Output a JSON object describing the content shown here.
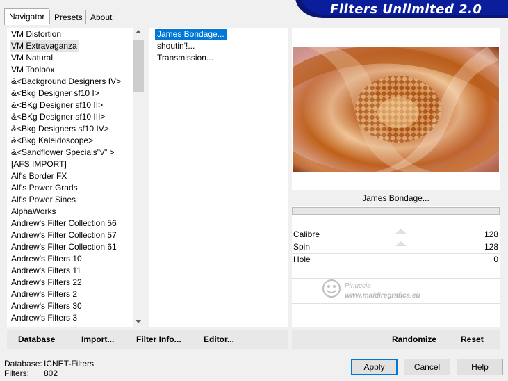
{
  "tabs": [
    "Navigator",
    "Presets",
    "About"
  ],
  "banner": "Filters Unlimited 2.0",
  "categories": [
    "VM Distortion",
    "VM Extravaganza",
    "VM Natural",
    "VM Toolbox",
    "&<Background Designers IV>",
    "&<Bkg Designer sf10 I>",
    "&<BKg Designer sf10 II>",
    "&<BKg Designer sf10 III>",
    "&<Bkg Designers sf10 IV>",
    "&<Bkg Kaleidoscope>",
    "&<Sandflower Specials\"v\" >",
    "[AFS IMPORT]",
    "Alf's Border FX",
    "Alf's Power Grads",
    "Alf's Power Sines",
    "AlphaWorks",
    "Andrew's Filter Collection 56",
    "Andrew's Filter Collection 57",
    "Andrew's Filter Collection 61",
    "Andrew's Filters 10",
    "Andrew's Filters 11",
    "Andrew's Filters 22",
    "Andrew's Filters 2",
    "Andrew's Filters 30",
    "Andrew's Filters 3"
  ],
  "selected_category": "VM Extravaganza",
  "filters": [
    "James Bondage...",
    "shoutin'!...",
    "Transmission..."
  ],
  "selected_filter": "James Bondage...",
  "filter_title": "James Bondage...",
  "params": [
    {
      "label": "Calibre",
      "value": "128"
    },
    {
      "label": "Spin",
      "value": "128"
    },
    {
      "label": "Hole",
      "value": "0"
    }
  ],
  "watermark": {
    "name": "Pinuccia",
    "site": "www.maidiregrafica.eu"
  },
  "bottom_left": {
    "database": "Database",
    "import": "Import...",
    "filter_info": "Filter Info...",
    "editor": "Editor..."
  },
  "bottom_right": {
    "randomize": "Randomize",
    "reset": "Reset"
  },
  "status": {
    "database_label": "Database:",
    "database_value": "ICNET-Filters",
    "filters_label": "Filters:",
    "filters_value": "802"
  },
  "dialog_buttons": {
    "apply": "Apply",
    "cancel": "Cancel",
    "help": "Help"
  }
}
